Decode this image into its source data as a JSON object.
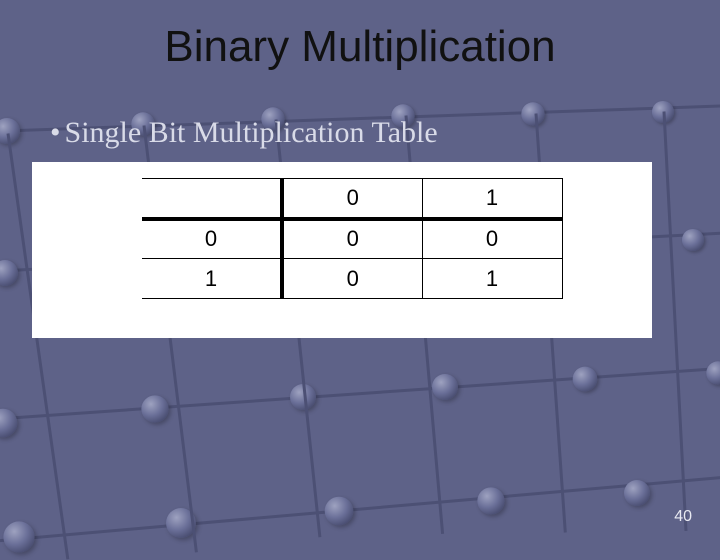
{
  "title": "Binary Multiplication",
  "bullet": "Single Bit Multiplication Table",
  "table": {
    "col_headers": [
      "0",
      "1"
    ],
    "rows": [
      {
        "head": "0",
        "cells": [
          "0",
          "0"
        ]
      },
      {
        "head": "1",
        "cells": [
          "0",
          "1"
        ]
      }
    ]
  },
  "page_number": "40",
  "chart_data": {
    "type": "table",
    "title": "Single Bit Multiplication Table",
    "columns": [
      "",
      "0",
      "1"
    ],
    "rows": [
      [
        "0",
        "0",
        "0"
      ],
      [
        "1",
        "0",
        "1"
      ]
    ]
  }
}
